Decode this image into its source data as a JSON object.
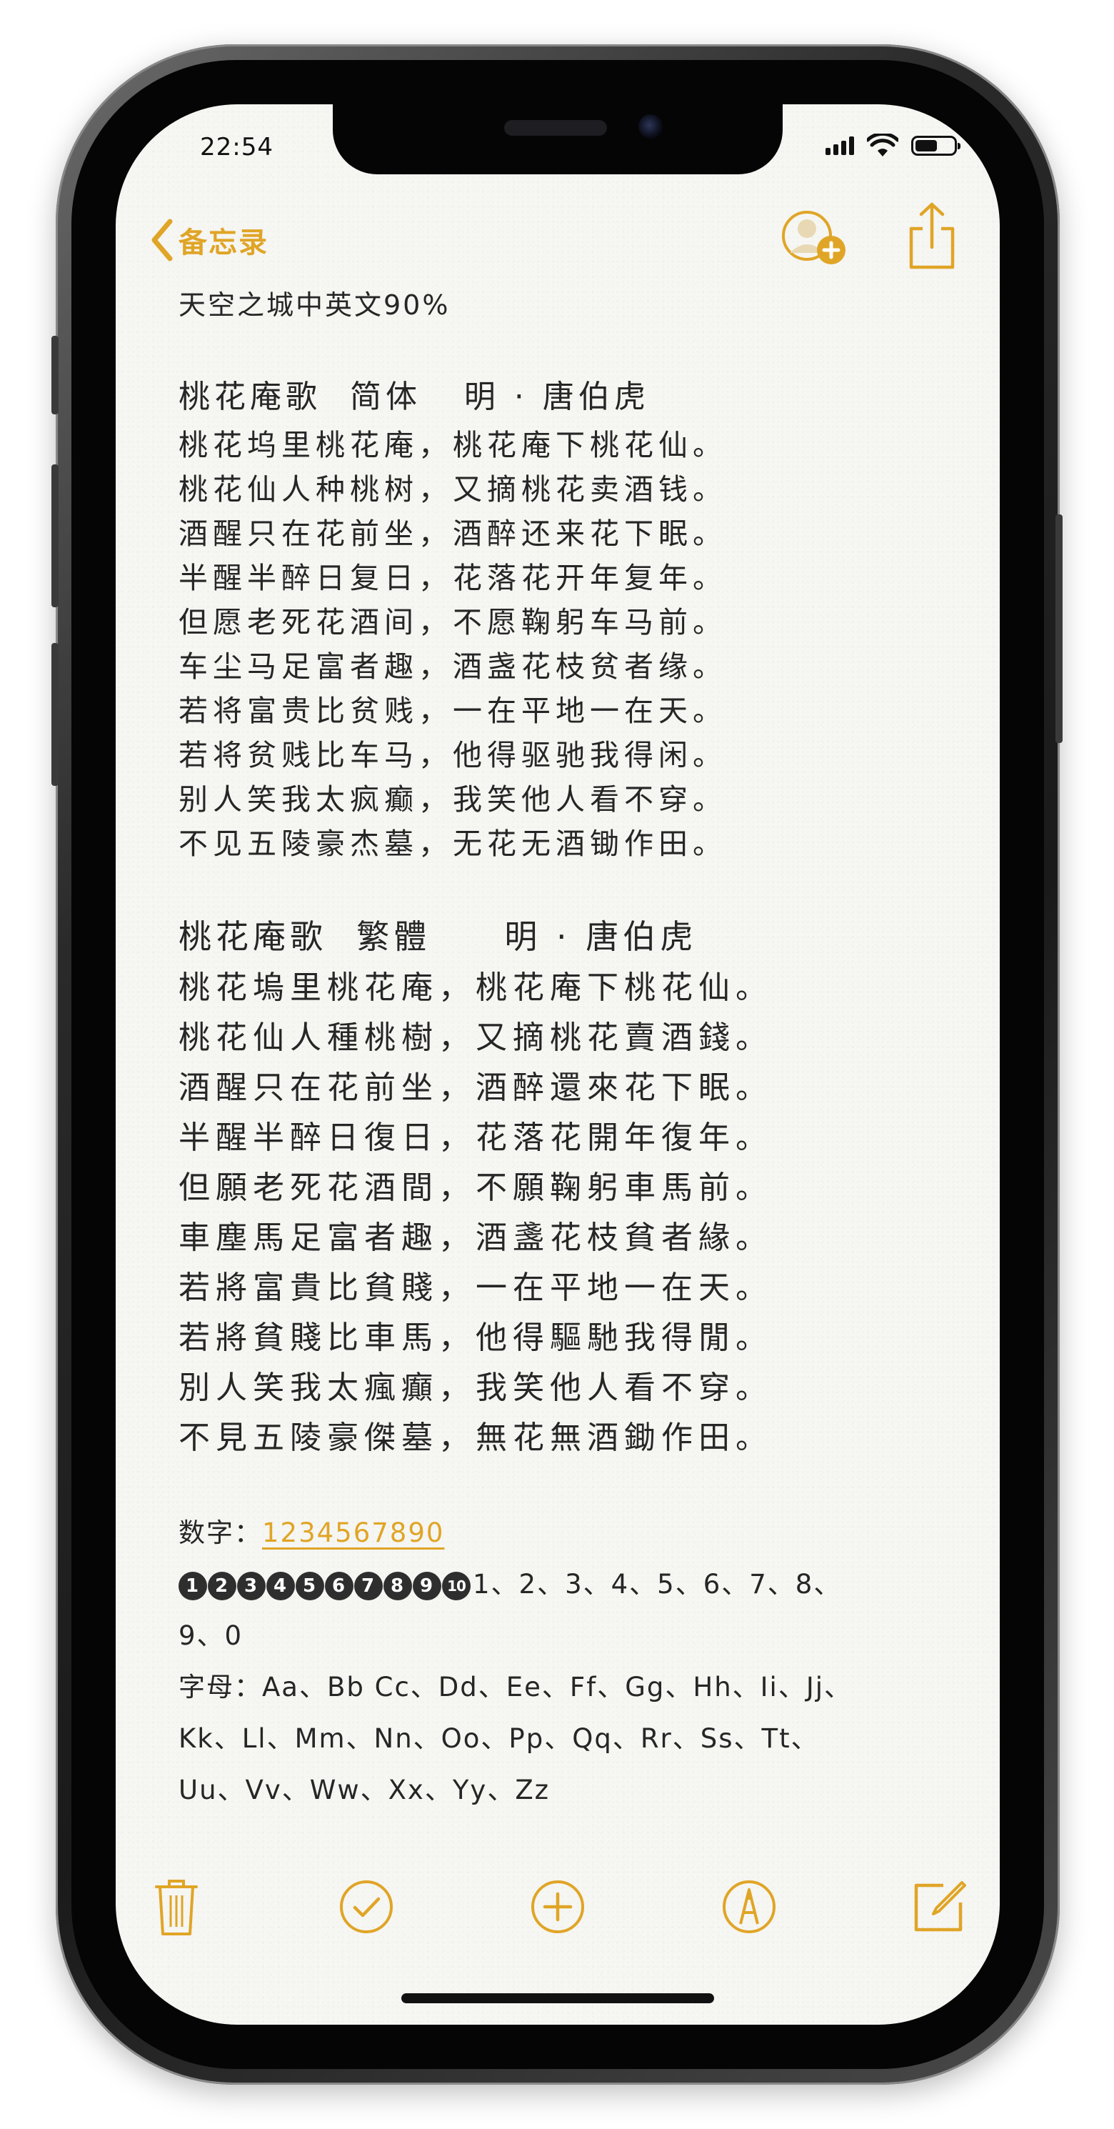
{
  "status_bar": {
    "time": "22:54"
  },
  "nav": {
    "back_label": "备忘录",
    "icons": [
      "chevron-left-icon",
      "add-person-icon",
      "share-icon"
    ]
  },
  "note": {
    "title": "天空之城中英文90%",
    "simplified": {
      "heading": "桃花庵歌  简体   明 · 唐伯虎",
      "lines": [
        "桃花坞里桃花庵，桃花庵下桃花仙。",
        "桃花仙人种桃树，又摘桃花卖酒钱。",
        "酒醒只在花前坐，酒醉还来花下眠。",
        "半醒半醉日复日，花落花开年复年。",
        "但愿老死花酒间，不愿鞠躬车马前。",
        "车尘马足富者趣，酒盏花枝贫者缘。",
        "若将富贵比贫贱，一在平地一在天。",
        "若将贫贱比车马，他得驱驰我得闲。",
        "别人笑我太疯癫，我笑他人看不穿。",
        "不见五陵豪杰墓，无花无酒锄作田。"
      ]
    },
    "traditional": {
      "heading": "桃花庵歌  繁體     明 · 唐伯虎",
      "lines": [
        "桃花塢里桃花庵，桃花庵下桃花仙。",
        "桃花仙人種桃樹，又摘桃花賣酒錢。",
        "酒醒只在花前坐，酒醉還來花下眠。",
        "半醒半醉日復日，花落花開年復年。",
        "但願老死花酒間，不願鞠躬車馬前。",
        "車塵馬足富者趣，酒盞花枝貧者緣。",
        "若將富貴比貧賤，一在平地一在天。",
        "若將貧賤比車馬，他得驅馳我得閒。",
        "別人笑我太瘋癲，我笑他人看不穿。",
        "不見五陵豪傑墓，無花無酒鋤作田。"
      ]
    },
    "numbers_label": "数字：",
    "numbers_link": "1234567890",
    "circled_numbers": [
      "1",
      "2",
      "3",
      "4",
      "5",
      "6",
      "7",
      "8",
      "9",
      "10"
    ],
    "numbers_tail_1": "1、2、3、4、5、6、7、8、",
    "numbers_tail_2": "9、0",
    "letters_line_1": "字母：Aa、Bb Cc、Dd、Ee、Ff、Gg、Hh、Ii、Jj、",
    "letters_line_2": "Kk、Ll、Mm、Nn、Oo、Pp、Qq、Rr、Ss、Tt、",
    "letters_line_3": "Uu、Vv、Ww、Xx、Yy、Zz"
  },
  "toolbar": {
    "icons": [
      "trash-icon",
      "checklist-icon",
      "add-icon",
      "markup-icon",
      "compose-icon"
    ]
  },
  "colors": {
    "accent": "#e0a526",
    "text": "#262626",
    "paper": "#f6f6f3"
  }
}
